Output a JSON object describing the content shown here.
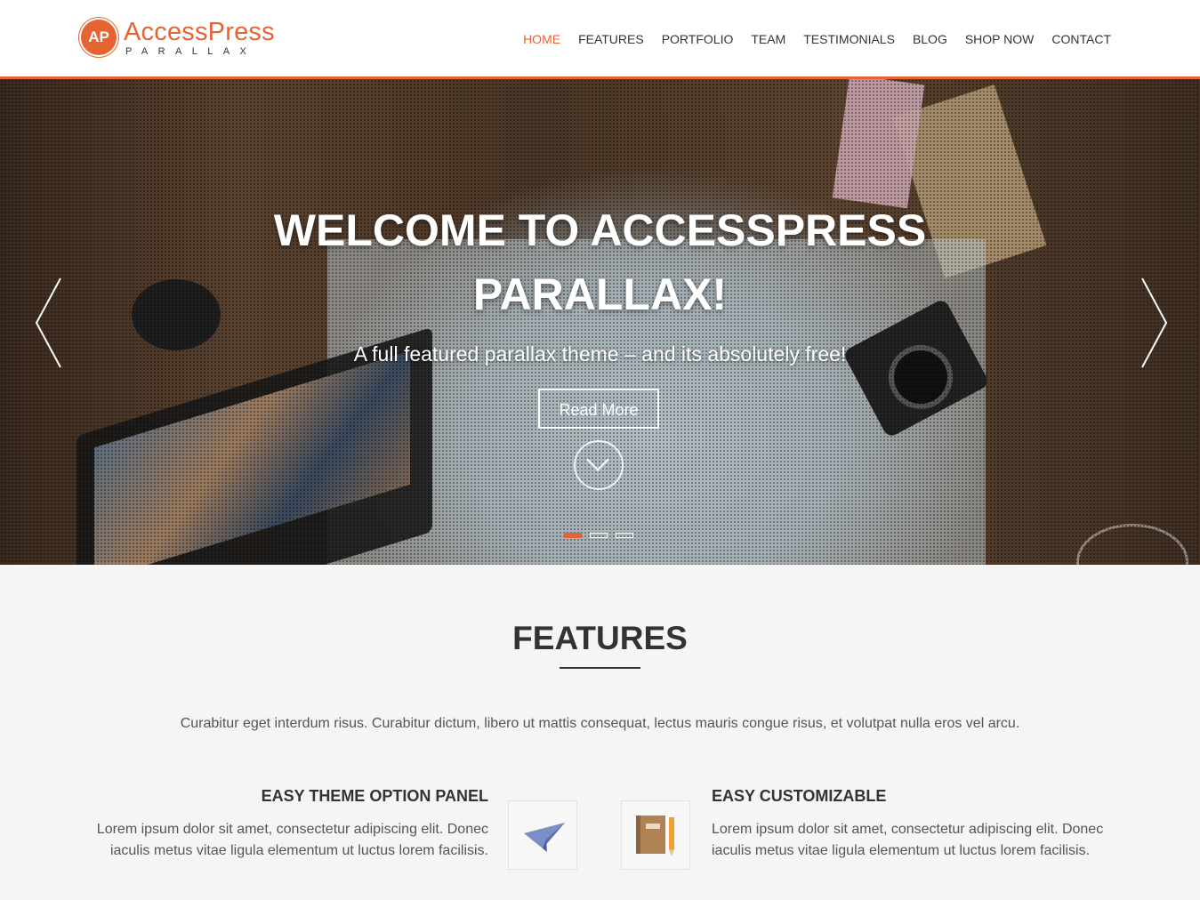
{
  "header": {
    "logo_badge": "AP",
    "logo_title": "AccessPress",
    "logo_subtitle": "PARALLAX",
    "nav": [
      {
        "label": "HOME",
        "active": true
      },
      {
        "label": "FEATURES",
        "active": false
      },
      {
        "label": "PORTFOLIO",
        "active": false
      },
      {
        "label": "TEAM",
        "active": false
      },
      {
        "label": "TESTIMONIALS",
        "active": false
      },
      {
        "label": "BLOG",
        "active": false
      },
      {
        "label": "SHOP NOW",
        "active": false
      },
      {
        "label": "CONTACT",
        "active": false
      }
    ]
  },
  "hero": {
    "title_line1": "WELCOME TO ACCESSPRESS",
    "title_line2": "PARALLAX!",
    "subtitle": "A full featured parallax theme – and its absolutely free!",
    "button_label": "Read More",
    "slides_total": 3,
    "active_slide": 1,
    "prev_icon": "chevron-left-icon",
    "next_icon": "chevron-right-icon",
    "scroll_icon": "chevron-down-circle-icon"
  },
  "features": {
    "title": "FEATURES",
    "description": "Curabitur eget interdum risus. Curabitur dictum, libero ut mattis consequat, lectus mauris congue risus, et volutpat nulla eros vel arcu.",
    "items": [
      {
        "title": "EASY THEME OPTION PANEL",
        "text": "Lorem ipsum dolor sit amet, consectetur adipiscing elit. Donec iaculis metus vitae ligula elementum ut luctus lorem facilisis.",
        "icon": "paper-plane-icon"
      },
      {
        "title": "EASY CUSTOMIZABLE",
        "text": "Lorem ipsum dolor sit amet, consectetur adipiscing elit. Donec iaculis metus vitae ligula elementum ut luctus lorem facilisis.",
        "icon": "notebook-pencil-icon"
      }
    ]
  },
  "colors": {
    "accent": "#e66432",
    "text_dark": "#333333",
    "text_body": "#555555",
    "section_bg": "#f5f5f5"
  }
}
